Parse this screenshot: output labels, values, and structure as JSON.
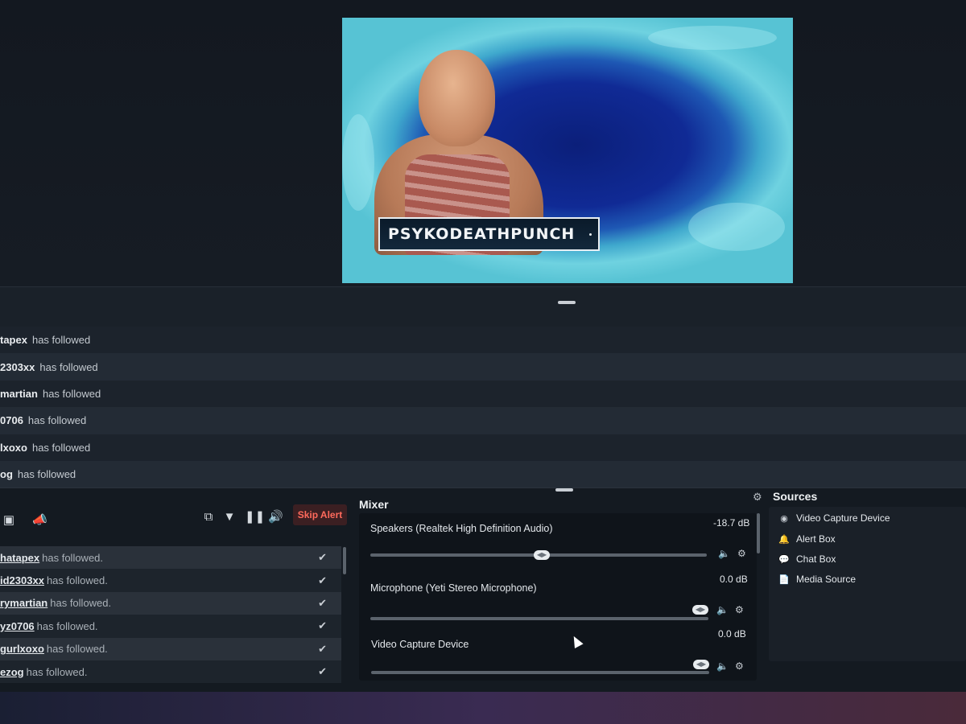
{
  "preview": {
    "streamer_name": "PSYKODEATHPUNCH"
  },
  "recent_events": [
    {
      "user": "tapex",
      "text": "has followed"
    },
    {
      "user": "2303xx",
      "text": "has followed"
    },
    {
      "user": "martian",
      "text": "has followed"
    },
    {
      "user": "0706",
      "text": "has followed"
    },
    {
      "user": "lxoxo",
      "text": "has followed"
    },
    {
      "user": "og",
      "text": "has followed"
    }
  ],
  "alerts": {
    "skip_label": "Skip Alert",
    "items": [
      {
        "user": "hatapex",
        "text": "has followed."
      },
      {
        "user": "id2303xx",
        "text": "has followed."
      },
      {
        "user": "rymartian",
        "text": "has followed."
      },
      {
        "user": "yz0706",
        "text": "has followed."
      },
      {
        "user": "gurlxoxo",
        "text": "has followed."
      },
      {
        "user": "ezog",
        "text": "has followed."
      }
    ]
  },
  "mixer": {
    "title": "Mixer",
    "channels": [
      {
        "name": "Speakers (Realtek High Definition Audio)",
        "db": "-18.7 dB",
        "level": 0.51
      },
      {
        "name": "Microphone (Yeti Stereo Microphone)",
        "db": "0.0 dB",
        "level": 1.0
      },
      {
        "name": "Video Capture Device",
        "db": "0.0 dB",
        "level": 1.0
      }
    ]
  },
  "sources": {
    "title": "Sources",
    "items": [
      {
        "label": "Video Capture Device",
        "icon": "webcam-icon"
      },
      {
        "label": "Alert Box",
        "icon": "bell-icon"
      },
      {
        "label": "Chat Box",
        "icon": "chat-icon"
      },
      {
        "label": "Media Source",
        "icon": "file-icon"
      }
    ]
  }
}
